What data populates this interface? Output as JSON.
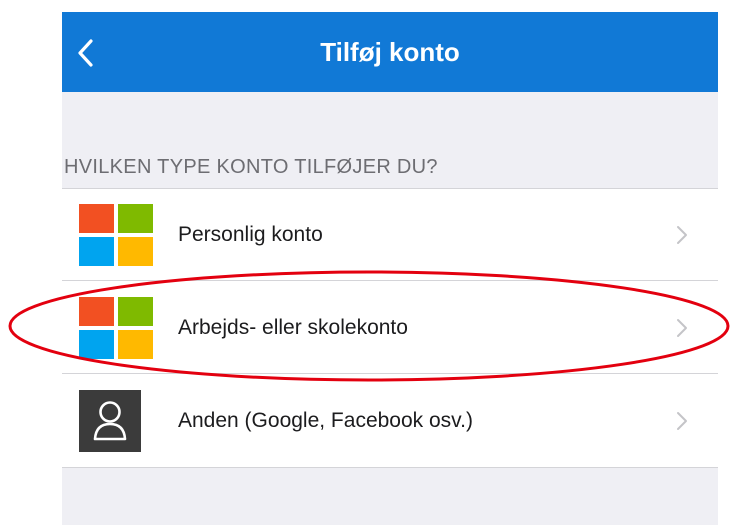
{
  "navbar": {
    "title": "Tilføj konto",
    "back_icon": "chevron-left-icon",
    "background": "#1179d6"
  },
  "section": {
    "header": "HVILKEN TYPE KONTO TILFØJER DU?"
  },
  "accounts": [
    {
      "label": "Personlig konto",
      "icon": "microsoft-logo-icon"
    },
    {
      "label": "Arbejds- eller skolekonto",
      "icon": "microsoft-logo-icon"
    },
    {
      "label": "Anden (Google, Facebook osv.)",
      "icon": "person-icon"
    }
  ],
  "annotation": {
    "highlighted_item": "Arbejds- eller skolekonto",
    "color": "#e3000f"
  }
}
